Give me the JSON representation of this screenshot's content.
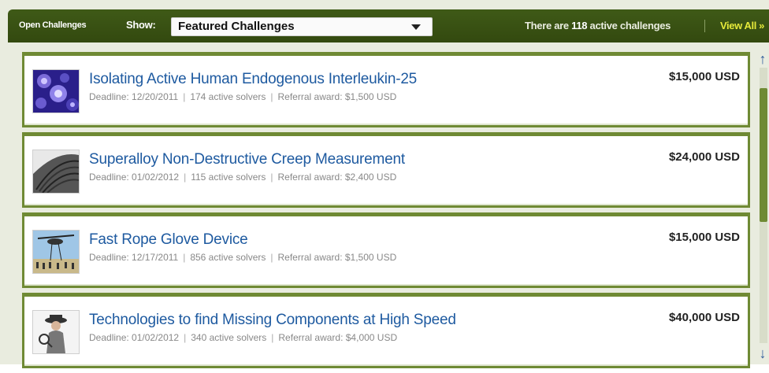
{
  "header": {
    "title": "Open Challenges",
    "show_label": "Show:",
    "filter_selected": "Featured Challenges",
    "count_prefix": "There are ",
    "count_value": "118",
    "count_suffix": " active challenges",
    "view_all": "View All »"
  },
  "challenges": [
    {
      "title": "Isolating Active Human Endogenous Interleukin-25",
      "deadline": "Deadline: 12/20/2011",
      "solvers": "174 active solvers",
      "referral": "Referral award: $1,500 USD",
      "award": "$15,000 USD",
      "thumb": "cells-image"
    },
    {
      "title": "Superalloy Non-Destructive Creep Measurement",
      "deadline": "Deadline: 01/02/2012",
      "solvers": "115 active solvers",
      "referral": "Referral award: $2,400 USD",
      "award": "$24,000 USD",
      "thumb": "turbine-image"
    },
    {
      "title": "Fast Rope Glove Device",
      "deadline": "Deadline: 12/17/2011",
      "solvers": "856 active solvers",
      "referral": "Referral award: $1,500 USD",
      "award": "$15,000 USD",
      "thumb": "helicopter-rope-image"
    },
    {
      "title": "Technologies to find Missing Components at High Speed",
      "deadline": "Deadline: 01/02/2012",
      "solvers": "340 active solvers",
      "referral": "Referral award: $4,000 USD",
      "award": "$40,000 USD",
      "thumb": "detective-image"
    }
  ],
  "colors": {
    "header_bg": "#3a5214",
    "card_border": "#6f8a34",
    "title_link": "#1e5aa0",
    "view_all": "#e5e93a"
  }
}
